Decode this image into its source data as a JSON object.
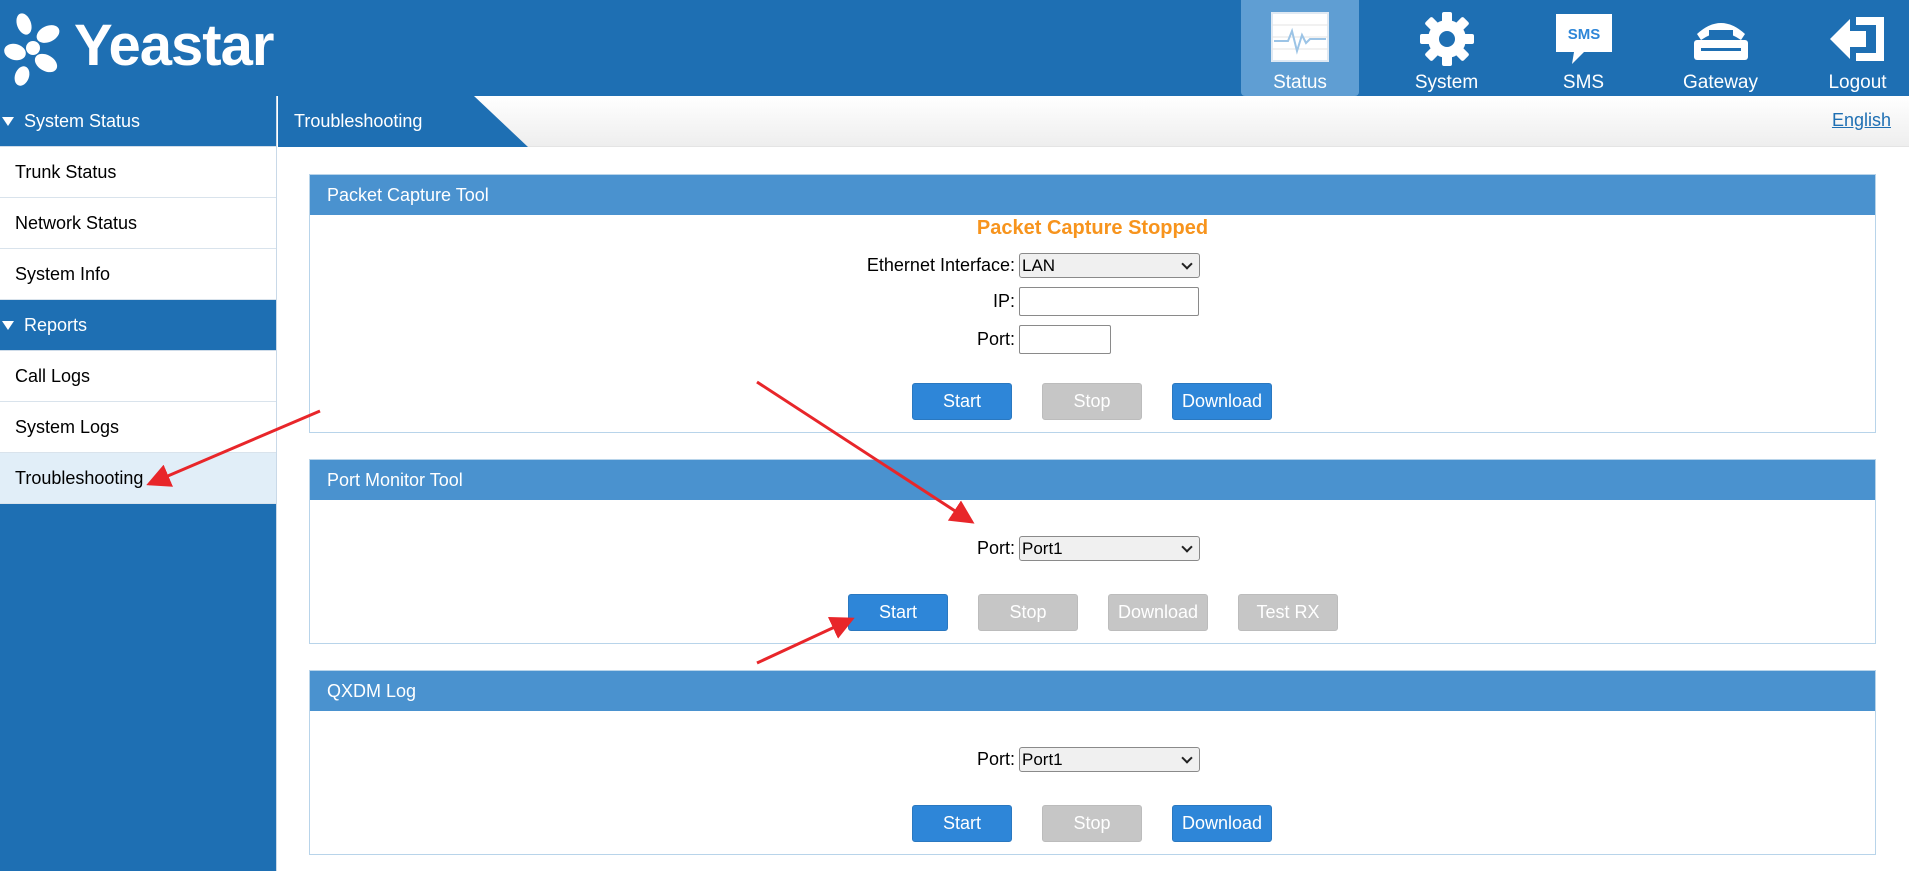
{
  "brand": {
    "name": "Yeastar"
  },
  "nav": [
    {
      "label": "Status",
      "icon": "status-monitor-icon",
      "active": true
    },
    {
      "label": "System",
      "icon": "gear-icon"
    },
    {
      "label": "SMS",
      "icon": "sms-icon",
      "icon_text": "SMS"
    },
    {
      "label": "Gateway",
      "icon": "gateway-phone-icon"
    },
    {
      "label": "Logout",
      "icon": "logout-arrow-icon"
    }
  ],
  "sidebar": {
    "groups": [
      {
        "label": "System Status",
        "items": [
          "Trunk Status",
          "Network Status",
          "System Info"
        ]
      },
      {
        "label": "Reports",
        "items": [
          "Call Logs",
          "System Logs",
          "Troubleshooting"
        ]
      }
    ],
    "active_item": "Troubleshooting"
  },
  "breadcrumb": {
    "current": "Troubleshooting"
  },
  "language": "English",
  "packet_capture": {
    "title": "Packet Capture Tool",
    "status": "Packet Capture Stopped",
    "interface_label": "Ethernet Interface:",
    "interface_value": "LAN",
    "ip_label": "IP:",
    "ip_value": "",
    "port_label": "Port:",
    "port_value": "",
    "buttons": {
      "start": "Start",
      "stop": "Stop",
      "download": "Download"
    }
  },
  "port_monitor": {
    "title": "Port Monitor Tool",
    "port_label": "Port:",
    "port_value": "Port1",
    "buttons": {
      "start": "Start",
      "stop": "Stop",
      "download": "Download",
      "test_rx": "Test RX"
    }
  },
  "qxdm": {
    "title": "QXDM Log",
    "port_label": "Port:",
    "port_value": "Port1",
    "buttons": {
      "start": "Start",
      "stop": "Stop",
      "download": "Download"
    }
  },
  "colors": {
    "primary": "#1e6fb3",
    "panel_header": "#4a92cf",
    "button_blue": "#2e86d8",
    "button_disabled": "#c6c6c6",
    "status_orange": "#f7941d",
    "annotation_red": "#e8262a"
  }
}
